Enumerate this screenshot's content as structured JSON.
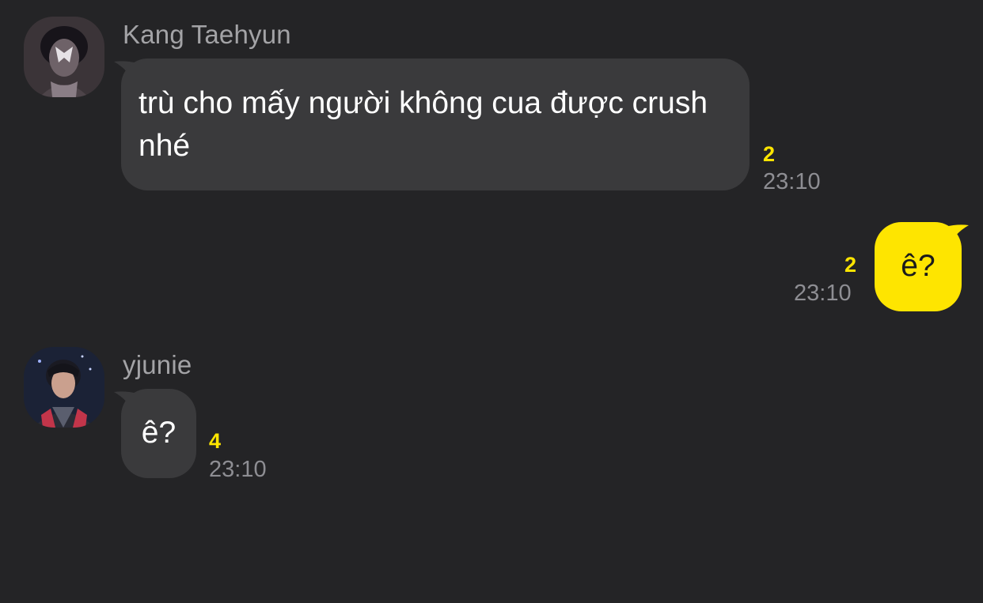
{
  "messages": [
    {
      "sender": "Kang Taehyun",
      "text": "trù cho mấy người không cua được crush nhé",
      "unread": "2",
      "time": "23:10"
    },
    {
      "sender": "",
      "text": "ê?",
      "unread": "2",
      "time": "23:10"
    },
    {
      "sender": "yjunie",
      "text": "ê?",
      "unread": "4",
      "time": "23:10"
    }
  ],
  "colors": {
    "background": "#242426",
    "incoming_bubble": "#3a3a3c",
    "outgoing_bubble": "#fee500",
    "unread_count": "#fee500",
    "time_text": "#8e8e93",
    "sender_text": "#a3a3a6"
  }
}
